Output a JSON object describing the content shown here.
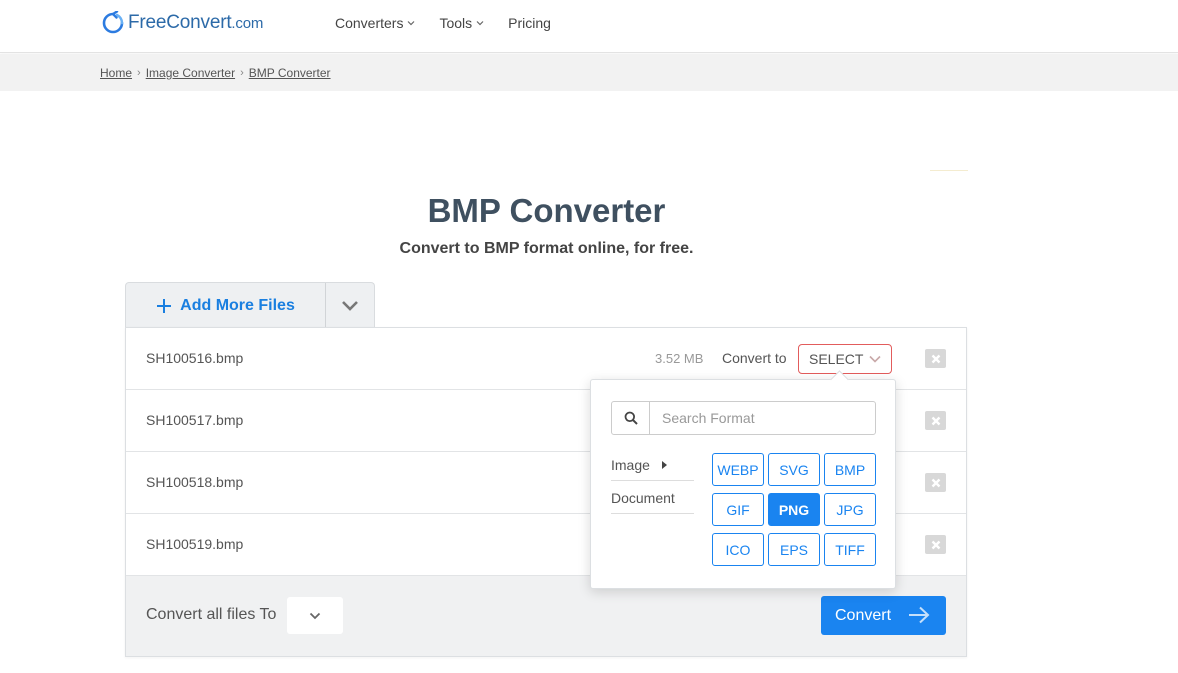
{
  "header": {
    "logo": {
      "free": "Free",
      "convert": "Convert",
      "dotcom": ".com"
    },
    "nav": [
      {
        "label": "Converters",
        "has_chevron": true
      },
      {
        "label": "Tools",
        "has_chevron": true
      },
      {
        "label": "Pricing",
        "has_chevron": false
      }
    ]
  },
  "breadcrumb": [
    "Home",
    "Image Converter",
    "BMP Converter"
  ],
  "page": {
    "title": "BMP Converter",
    "subtitle_bold": "Convert to BMP format online, for free."
  },
  "add_files": {
    "label": "Add More Files"
  },
  "files": [
    {
      "name": "SH100516.bmp",
      "size": "3.52 MB",
      "convert_to_label": "Convert to",
      "select_label": "SELECT"
    },
    {
      "name": "SH100517.bmp"
    },
    {
      "name": "SH100518.bmp"
    },
    {
      "name": "SH100519.bmp"
    }
  ],
  "footer": {
    "convert_all_label": "Convert all files To",
    "convert_button": "Convert"
  },
  "popup": {
    "search_placeholder": "Search Format",
    "categories": [
      "Image",
      "Document"
    ],
    "formats": [
      "WEBP",
      "SVG",
      "BMP",
      "GIF",
      "PNG",
      "JPG",
      "ICO",
      "EPS",
      "TIFF"
    ],
    "active_format": "PNG"
  },
  "colors": {
    "brand_blue": "#1a84f0",
    "select_border": "#e25c5c",
    "title": "#3f5060"
  }
}
